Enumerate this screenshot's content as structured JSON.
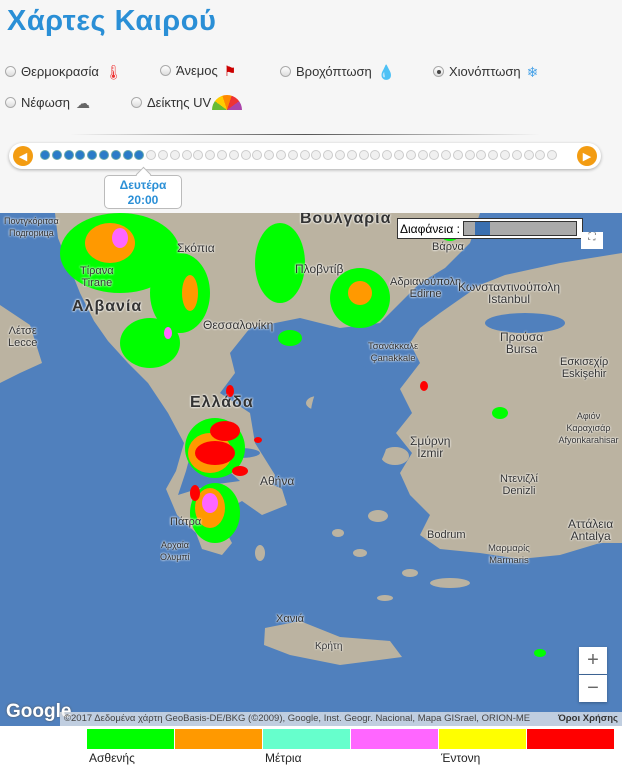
{
  "title": "Χάρτες Καιρού",
  "layers": [
    {
      "label": "Θερμοκρασία",
      "icon": "thermometer-icon",
      "selected": false
    },
    {
      "label": "Άνεμος",
      "icon": "wind-flag-icon",
      "selected": false
    },
    {
      "label": "Βροχόπτωση",
      "icon": "raindrop-icon",
      "selected": false
    },
    {
      "label": "Χιονόπτωση",
      "icon": "snowflake-icon",
      "selected": true
    },
    {
      "label": "Νέφωση",
      "icon": "cloud-icon",
      "selected": false
    },
    {
      "label": "Δείκτης UV",
      "icon": "uv-gauge-icon",
      "selected": false
    }
  ],
  "timeline": {
    "total_steps": 44,
    "current_step": 9,
    "day": "Δευτέρα",
    "time": "20:00",
    "prev_icon": "chevron-left-icon",
    "next_icon": "chevron-right-icon"
  },
  "map": {
    "transparency_label": "Διαφάνεια :",
    "transparency_value": 0.1,
    "zoom_in": "+",
    "zoom_out": "−",
    "logo": "Google",
    "attribution": "©2017 Δεδομένα χάρτη GeoBasis-DE/BKG (©2009), Google, Inst. Geogr. Nacional, Mapa GISrael, ORION-ME",
    "terms": "Όροι Χρήσης",
    "labels": [
      "Ποντγκόριτσα",
      "Подгорица",
      "Τίρανα",
      "Tirane",
      "Αλβανία",
      "Σκόπια",
      "Βουλγαρία",
      "Πλοβντίβ",
      "Αδριανούπολη",
      "Edirne",
      "Κωνσταντινούπολη",
      "Istanbul",
      "Θεσσαλονίκη",
      "Λέτσε",
      "Lecce",
      "Τσανάκκαλε",
      "Çanakkale",
      "Προύσα",
      "Bursa",
      "Εσκισεχίρ",
      "Eskişehir",
      "Ελλάδα",
      "Πάτρα",
      "Αρχαία Ολυμπία",
      "Αθήνα",
      "Σμύρνη",
      "İzmir",
      "Αφιόν Καραχισάρ",
      "Afyonkarahisar",
      "Ντενιζλί",
      "Denizli",
      "Αττάλεια",
      "Antalya",
      "Bodrum",
      "Μαρμαρίς",
      "Marmaris",
      "Χανιά",
      "Κρήτη",
      "Βάρνα"
    ]
  },
  "legend": {
    "colors": [
      "#00ff00",
      "#ff9900",
      "#66ffcc",
      "#ff66ff",
      "#ffff00",
      "#ff0000"
    ],
    "labels": [
      "Ασθενής",
      "Μέτρια",
      "Έντονη"
    ]
  }
}
